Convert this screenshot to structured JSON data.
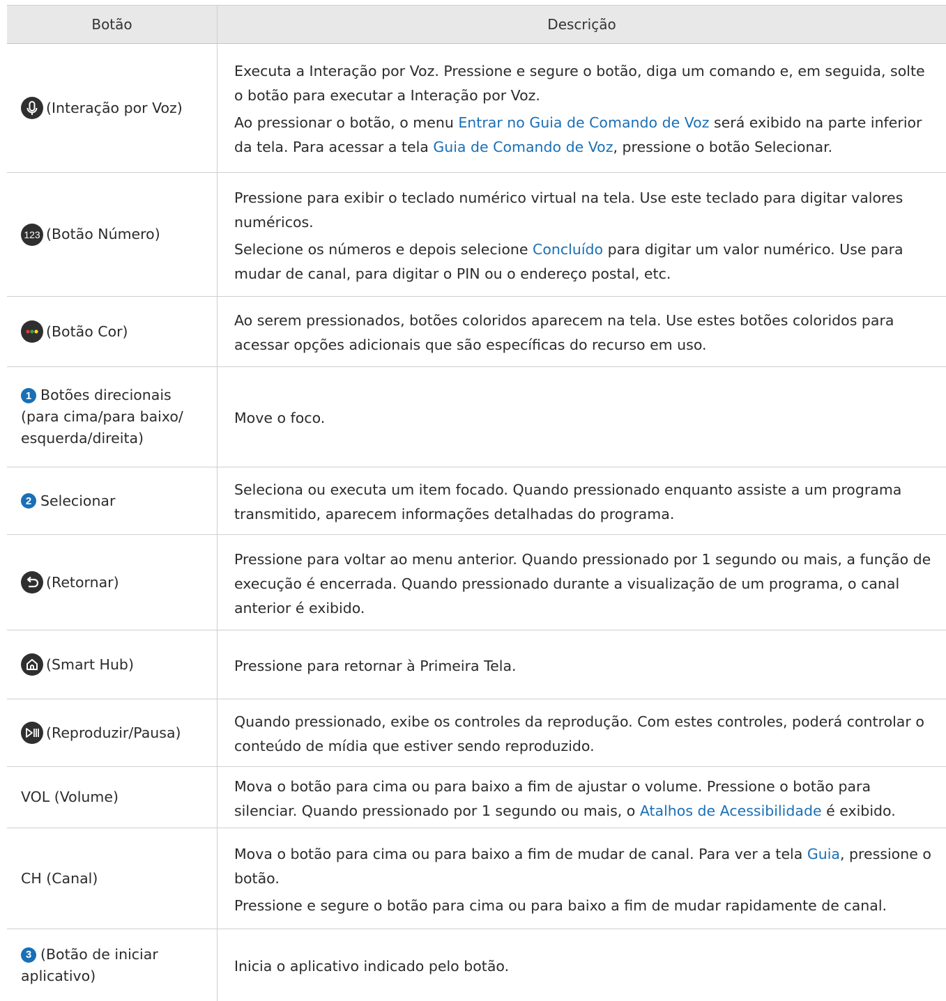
{
  "header": {
    "col_button": "Botão",
    "col_description": "Descrição"
  },
  "rows": [
    {
      "label": "(Interação por Voz)",
      "d1": [
        "Executa a Interação por Voz. Pressione e segure o botão, diga um comando e, em seguida, solte o botão para executar a Interação por Voz."
      ],
      "d2": [
        "Ao pressionar o botão, o menu ",
        "Entrar no Guia de Comando de Voz",
        " será exibido na parte inferior da tela. Para acessar a tela ",
        "Guia de Comando de Voz",
        ", pressione o botão Selecionar."
      ]
    },
    {
      "label": "(Botão Número)",
      "d1": [
        "Pressione para exibir o teclado numérico virtual na tela. Use este teclado para digitar valores numéricos."
      ],
      "d2": [
        "Selecione os números e depois selecione ",
        "Concluído",
        " para digitar um valor numérico. Use para mudar de canal, para digitar o PIN ou o endereço postal, etc."
      ]
    },
    {
      "label": "(Botão Cor)",
      "d1": [
        "Ao serem pressionados, botões coloridos aparecem na tela. Use estes botões coloridos para acessar opções adicionais que são específicas do recurso em uso."
      ]
    },
    {
      "num": "1",
      "label": "Botões direcionais (para cima/para baixo/ esquerda/direita)",
      "d1": [
        "Move o foco."
      ]
    },
    {
      "num": "2",
      "label": "Selecionar",
      "d1": [
        "Seleciona ou executa um item focado. Quando pressionado enquanto assiste a um programa transmitido, aparecem informações detalhadas do programa."
      ]
    },
    {
      "label": "(Retornar)",
      "d1": [
        "Pressione para voltar ao menu anterior. Quando pressionado por 1 segundo ou mais, a função de execução é encerrada. Quando pressionado durante a visualização de um programa, o canal anterior é exibido."
      ]
    },
    {
      "label": "(Smart Hub)",
      "d1": [
        "Pressione para retornar à Primeira Tela."
      ]
    },
    {
      "label": "(Reproduzir/Pausa)",
      "d1": [
        "Quando pressionado, exibe os controles da reprodução. Com estes controles, poderá controlar o conteúdo de mídia que estiver sendo reproduzido."
      ]
    },
    {
      "label": "VOL (Volume)",
      "d1": [
        "Mova o botão para cima ou para baixo a fim de ajustar o volume. Pressione o botão para silenciar. Quando pressionado por 1 segundo ou mais, o ",
        "Atalhos de Acessibilidade",
        " é exibido."
      ]
    },
    {
      "label": "CH (Canal)",
      "d1": [
        "Mova o botão para cima ou para baixo a fim de mudar de canal. Para ver a tela ",
        "Guia",
        ", pressione o botão."
      ],
      "d2": [
        "Pressione e segure o botão para cima ou para baixo a fim de mudar rapidamente de canal."
      ]
    },
    {
      "num": "3",
      "label": "(Botão de iniciar aplicativo)",
      "d1": [
        "Inicia o aplicativo indicado pelo botão."
      ]
    }
  ],
  "colors": {
    "header_bg": "#e8e8e8",
    "link": "#1a6fb5",
    "icon": "#2f2f2f"
  },
  "icons": [
    "microphone-icon",
    "number-123-icon",
    "color-dots-icon",
    "return-icon",
    "home-icon",
    "play-pause-icon"
  ]
}
